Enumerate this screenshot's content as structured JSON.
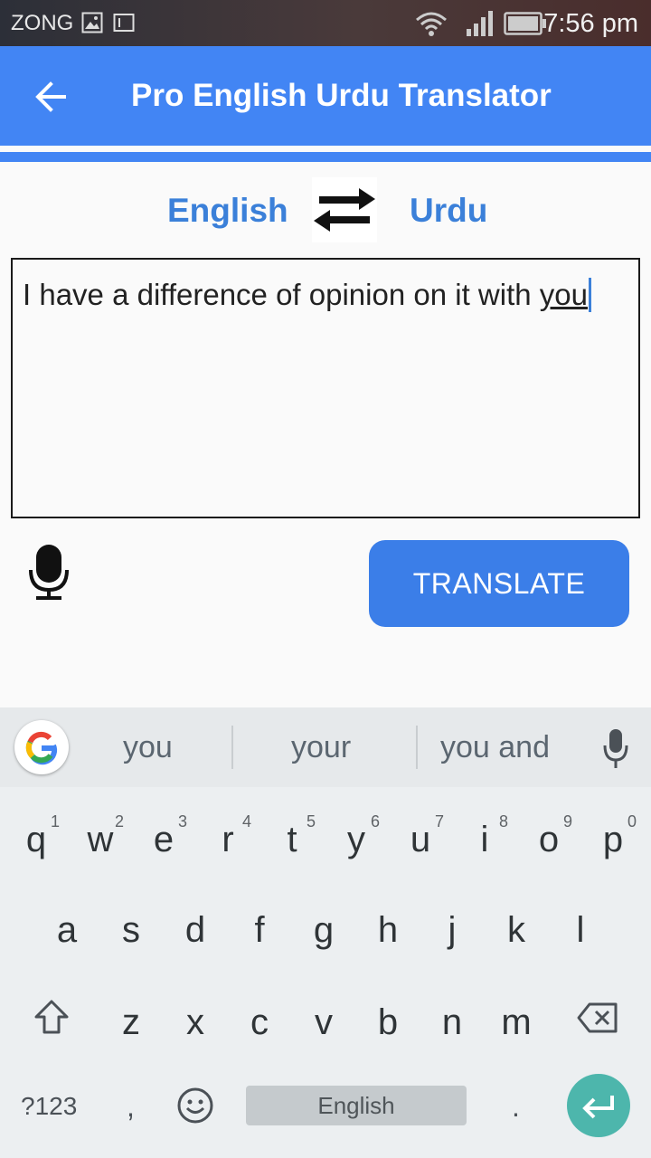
{
  "status_bar": {
    "carrier": "ZONG",
    "time": "7:56 pm"
  },
  "app_bar": {
    "title": "Pro English Urdu Translator"
  },
  "languages": {
    "source": "English",
    "target": "Urdu"
  },
  "input": {
    "text_before": "I have a difference of opinion on it with ",
    "text_underlined": "you"
  },
  "actions": {
    "translate_label": "TRANSLATE"
  },
  "keyboard": {
    "suggestions": [
      "you",
      "your",
      "you and"
    ],
    "row1": [
      {
        "key": "q",
        "hint": "1"
      },
      {
        "key": "w",
        "hint": "2"
      },
      {
        "key": "e",
        "hint": "3"
      },
      {
        "key": "r",
        "hint": "4"
      },
      {
        "key": "t",
        "hint": "5"
      },
      {
        "key": "y",
        "hint": "6"
      },
      {
        "key": "u",
        "hint": "7"
      },
      {
        "key": "i",
        "hint": "8"
      },
      {
        "key": "o",
        "hint": "9"
      },
      {
        "key": "p",
        "hint": "0"
      }
    ],
    "row2": [
      "a",
      "s",
      "d",
      "f",
      "g",
      "h",
      "j",
      "k",
      "l"
    ],
    "row3": [
      "z",
      "x",
      "c",
      "v",
      "b",
      "n",
      "m"
    ],
    "symbols_label": "?123",
    "comma": ",",
    "period": ".",
    "space_label": "English"
  },
  "colors": {
    "primary": "#4285f4",
    "accent_text": "#3b80d9",
    "button": "#3b7ee8",
    "enter": "#4db6ac"
  }
}
